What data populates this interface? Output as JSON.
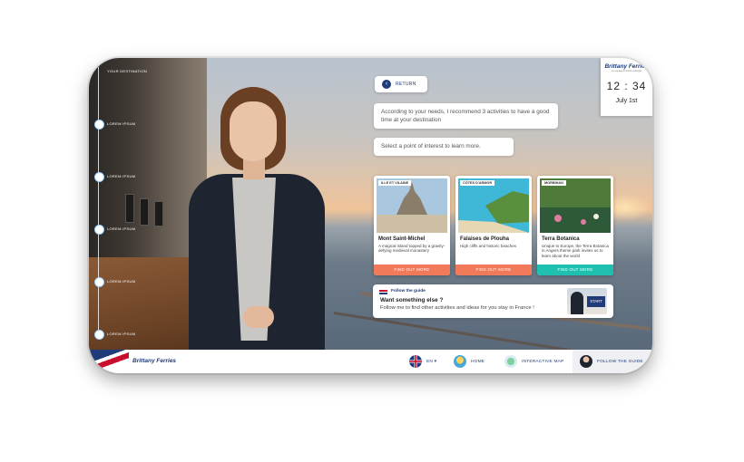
{
  "sidebar": {
    "steps": [
      {
        "label": "YOUR DESTINATION"
      },
      {
        "label": "LOREM IPSUM"
      },
      {
        "label": "LOREM IPSUM"
      },
      {
        "label": "LOREM IPSUM"
      },
      {
        "label": "LOREM IPSUM"
      },
      {
        "label": "LOREM IPSUM"
      }
    ]
  },
  "return_button": {
    "label": "RETURN",
    "icon": "chevron-left-icon"
  },
  "bubbles": {
    "recommend": "According to your needs, I recommend 3 activities to have a good time at your destination",
    "select": "Select a point of interest to learn more."
  },
  "cards": [
    {
      "tag": "ILLE ET VILAINE",
      "title": "Mont Saint-Michel",
      "desc": "A magical island topped by a gravity-defying medieval monastery",
      "button": "FIND OUT MORE",
      "button_color": "#f07a5a"
    },
    {
      "tag": "CÔTES D'ARMOR",
      "title": "Falaises de Plouha",
      "desc": "High cliffs and historic beaches",
      "button": "FIND OUT MORE",
      "button_color": "#f07a5a"
    },
    {
      "tag": "MORBIHAN",
      "title": "Terra Botanica",
      "desc": "Unique to Europe, the Terra Botanica in Angers theme park invites us to learn about the world",
      "button": "FIND OUT MORE",
      "button_color": "#20c0b0"
    }
  ],
  "guide": {
    "header": "Follow the guide",
    "question": "Want something else ?",
    "text": "Follow me to find other activities and ideas for you stay in France !",
    "start": "START"
  },
  "clock": {
    "brand": "Brittany Ferries",
    "tagline": "Le voyage en bonne énergie",
    "time": "12 : 34",
    "date": "July 1st"
  },
  "bottombar": {
    "logo": "Brittany Ferries",
    "language": "EN ▾",
    "home": "HOME",
    "map": "INTERACTIVE MAP",
    "follow": "FOLLOW THE GUIDE"
  },
  "colors": {
    "brand_blue": "#1f3b7a",
    "brand_red": "#c8102e",
    "coral": "#f07a5a",
    "teal": "#20c0b0"
  }
}
